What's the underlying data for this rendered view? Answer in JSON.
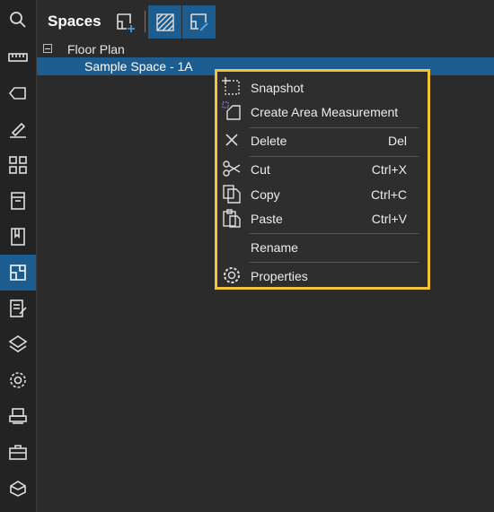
{
  "header": {
    "title": "Spaces",
    "add_space_icon": "add-space-icon",
    "hatch_icon": "hatch-fill-icon",
    "edit_space_icon": "edit-space-icon"
  },
  "rail": {
    "icons": [
      "search-icon",
      "ruler-icon",
      "tag-icon",
      "markup-pen-icon",
      "grid-view-icon",
      "archive-icon",
      "bookmark-icon",
      "spaces-icon",
      "markups-list-icon",
      "layers-icon",
      "settings-icon",
      "printer-icon",
      "toolbox-icon",
      "3d-view-icon"
    ],
    "active": "spaces-icon"
  },
  "tree": {
    "floor_plan": "Floor Plan",
    "sample_space": "Sample Space - 1A"
  },
  "context_menu": {
    "snapshot": "Snapshot",
    "create_area": "Create Area Measurement",
    "delete": "Delete",
    "delete_shortcut": "Del",
    "cut": "Cut",
    "cut_shortcut": "Ctrl+X",
    "copy": "Copy",
    "copy_shortcut": "Ctrl+C",
    "paste": "Paste",
    "paste_shortcut": "Ctrl+V",
    "rename": "Rename",
    "properties": "Properties"
  },
  "colors": {
    "accent": "#1d5c8f",
    "highlight_border": "#f0c33c",
    "background": "#2b2b2b"
  }
}
